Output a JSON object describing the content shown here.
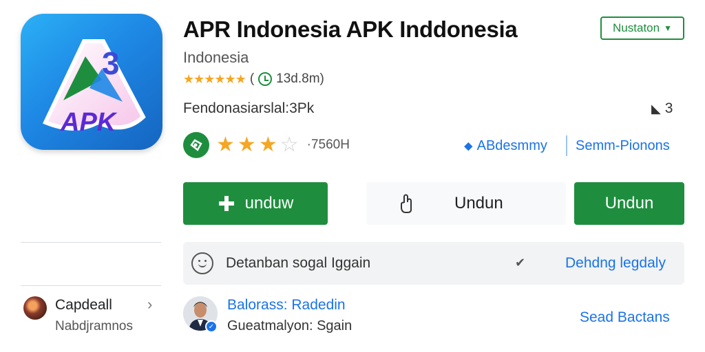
{
  "app": {
    "title": "APR Indonesia APK Inddonesia",
    "subtitle": "Indonesia",
    "rating_small": "(",
    "rating_small_value": "13d.8m)",
    "icon_text": "APK",
    "developer_line": "Fendonasiarslal:3Pk",
    "share_count": "3",
    "rating_stars": 3,
    "rating_max": 4,
    "rating_count": "·7560H"
  },
  "dropdown": {
    "label": "Nustaton"
  },
  "links": {
    "primary": "ABdesmmy",
    "secondary": "Semm-Pionons"
  },
  "buttons": {
    "b1": "unduw",
    "b2": "Undun",
    "b3": "Undun"
  },
  "info_bar": {
    "text": "Detanban sogal Iggain",
    "link": "Dehdng legdaly"
  },
  "category": {
    "title": "Capdeall",
    "sub": "Nabdjramnos"
  },
  "author": {
    "name": "Balorass: Radedin",
    "sub": "Gueatmalyon: Sgain",
    "link": "Sead Bactans"
  },
  "colors": {
    "accent_green": "#1e8e3e",
    "link_blue": "#1a73e8",
    "star": "#f5a623"
  }
}
